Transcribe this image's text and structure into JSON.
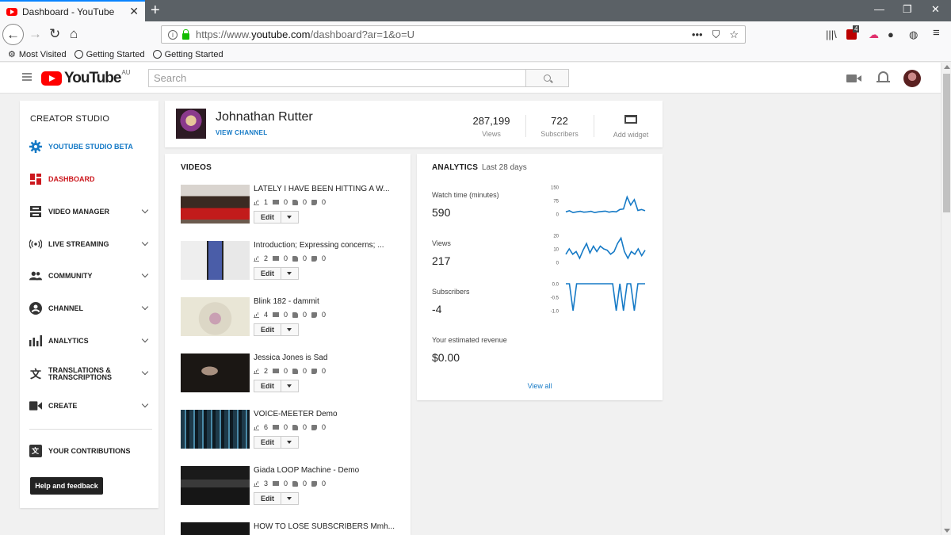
{
  "browser": {
    "tab_title": "Dashboard - YouTube",
    "url_prefix": "https://www.",
    "url_host": "youtube.com",
    "url_path": "/dashboard?ar=1&o=U",
    "bookmarks": [
      "Most Visited",
      "Getting Started",
      "Getting Started"
    ],
    "badge_count": "4"
  },
  "youtube": {
    "logo_text": "YouTube",
    "region": "AU",
    "search_placeholder": "Search"
  },
  "sidebar": {
    "title": "CREATOR STUDIO",
    "items": [
      {
        "label": "YOUTUBE STUDIO BETA"
      },
      {
        "label": "DASHBOARD"
      },
      {
        "label": "VIDEO MANAGER"
      },
      {
        "label": "LIVE STREAMING"
      },
      {
        "label": "COMMUNITY"
      },
      {
        "label": "CHANNEL"
      },
      {
        "label": "ANALYTICS"
      },
      {
        "label": "TRANSLATIONS &"
      },
      {
        "label": "TRANSCRIPTIONS"
      },
      {
        "label": "CREATE"
      },
      {
        "label": "YOUR CONTRIBUTIONS"
      }
    ],
    "help_label": "Help and feedback"
  },
  "channel": {
    "name": "Johnathan Rutter",
    "view_channel": "VIEW CHANNEL",
    "views_value": "287,199",
    "views_label": "Views",
    "subs_value": "722",
    "subs_label": "Subscribers",
    "add_widget": "Add widget"
  },
  "videos": {
    "title": "VIDEOS",
    "edit_label": "Edit",
    "items": [
      {
        "title": "LATELY I HAVE BEEN HITTING A W...",
        "views": "1",
        "comments": "0",
        "likes": "0",
        "dislikes": "0"
      },
      {
        "title": "Introduction; Expressing concerns; ...",
        "views": "2",
        "comments": "0",
        "likes": "0",
        "dislikes": "0"
      },
      {
        "title": "Blink 182 - dammit",
        "views": "4",
        "comments": "0",
        "likes": "0",
        "dislikes": "0"
      },
      {
        "title": "Jessica Jones is Sad",
        "views": "2",
        "comments": "0",
        "likes": "0",
        "dislikes": "0"
      },
      {
        "title": "VOICE-MEETER Demo",
        "views": "6",
        "comments": "0",
        "likes": "0",
        "dislikes": "0"
      },
      {
        "title": "Giada LOOP Machine - Demo",
        "views": "3",
        "comments": "0",
        "likes": "0",
        "dislikes": "0"
      },
      {
        "title": "HOW TO LOSE SUBSCRIBERS Mmh..."
      }
    ]
  },
  "analytics": {
    "title": "ANALYTICS",
    "period": "Last 28 days",
    "view_all": "View all",
    "metrics": [
      {
        "label": "Watch time (minutes)",
        "value": "590",
        "ticks": [
          "150",
          "75",
          "0"
        ]
      },
      {
        "label": "Views",
        "value": "217",
        "ticks": [
          "20",
          "10",
          "0"
        ]
      },
      {
        "label": "Subscribers",
        "value": "-4",
        "ticks": [
          "0.0",
          "-0.5",
          "-1.0"
        ]
      },
      {
        "label": "Your estimated revenue",
        "value": "$0.00"
      }
    ]
  },
  "chart_data": [
    {
      "type": "line",
      "title": "Watch time (minutes)",
      "ylim": [
        0,
        150
      ],
      "values": [
        12,
        18,
        8,
        12,
        15,
        10,
        12,
        15,
        8,
        12,
        14,
        16,
        10,
        14,
        12,
        25,
        28,
        95,
        50,
        80,
        20,
        25,
        18
      ]
    },
    {
      "type": "line",
      "title": "Views",
      "ylim": [
        0,
        20
      ],
      "values": [
        6,
        10,
        6,
        8,
        3,
        9,
        14,
        7,
        12,
        8,
        12,
        10,
        9,
        6,
        8,
        14,
        18,
        8,
        3,
        8,
        6,
        10,
        5,
        9
      ]
    },
    {
      "type": "line",
      "title": "Subscribers",
      "ylim": [
        -1.0,
        0.0
      ],
      "values": [
        0,
        0,
        -1,
        0,
        0,
        0,
        0,
        0,
        0,
        0,
        0,
        0,
        0,
        0,
        -1,
        0,
        -1,
        0,
        0,
        -1,
        0,
        0,
        0
      ]
    }
  ]
}
